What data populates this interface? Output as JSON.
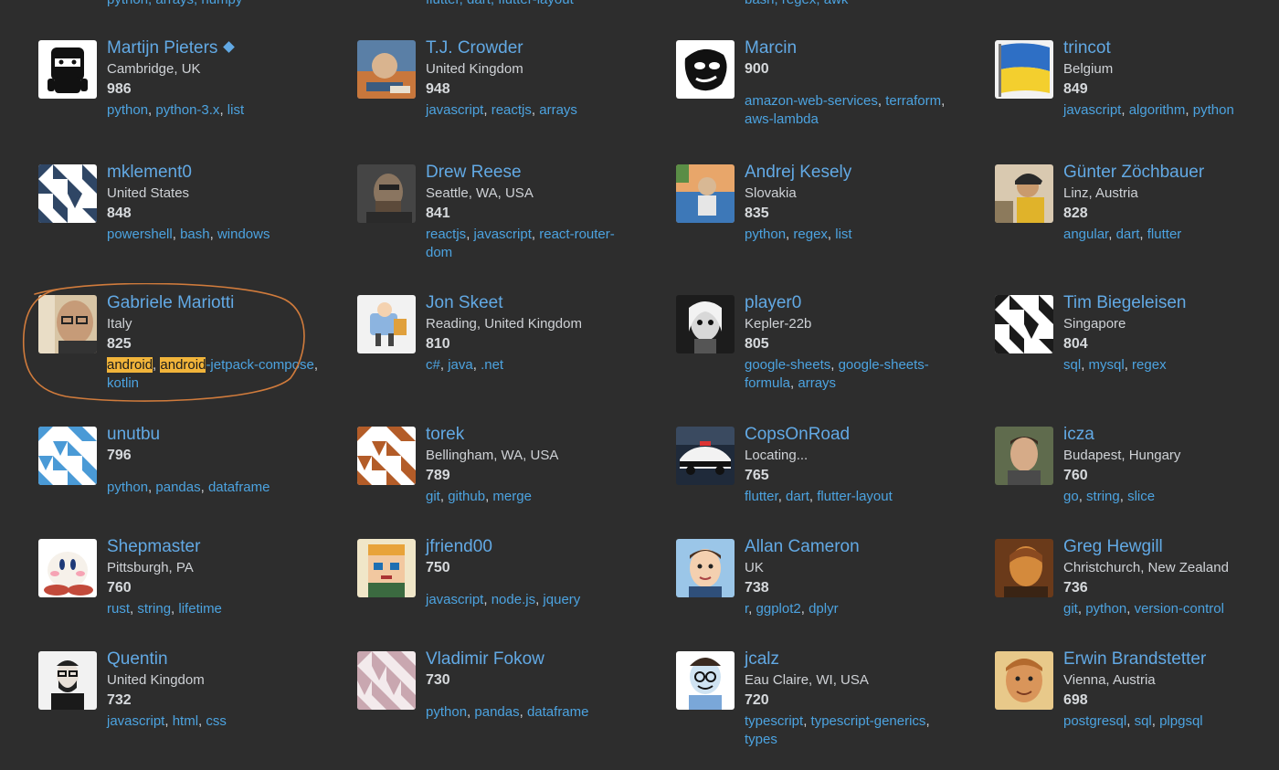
{
  "top_strip": [
    "python, arrays, numpy",
    "flutter, dart, flutter-layout",
    "bash, regex, awk"
  ],
  "users": [
    {
      "name": "Martijn Pieters",
      "moderator": true,
      "location": "Cambridge, UK",
      "score": "986",
      "tags": [
        "python",
        "python-3.x",
        "list"
      ],
      "avatar": "ninja"
    },
    {
      "name": "T.J. Crowder",
      "location": "United Kingdom",
      "score": "948",
      "tags": [
        "javascript",
        "reactjs",
        "arrays"
      ],
      "avatar": "photo-blue"
    },
    {
      "name": "Marcin",
      "location": "",
      "score": "900",
      "tags": [
        "amazon-web-services",
        "terraform",
        "aws-lambda"
      ],
      "avatar": "sketch"
    },
    {
      "name": "trincot",
      "location": "Belgium",
      "score": "849",
      "tags": [
        "javascript",
        "algorithm",
        "python"
      ],
      "avatar": "ukraine-flag"
    },
    {
      "name": "mklement0",
      "location": "United States",
      "score": "848",
      "tags": [
        "powershell",
        "bash",
        "windows"
      ],
      "avatar": "identicon-navy"
    },
    {
      "name": "Drew Reese",
      "location": "Seattle, WA, USA",
      "score": "841",
      "tags": [
        "reactjs",
        "javascript",
        "react-router-dom"
      ],
      "avatar": "photo-dark"
    },
    {
      "name": "Andrej Kesely",
      "location": "Slovakia",
      "score": "835",
      "tags": [
        "python",
        "regex",
        "list"
      ],
      "avatar": "photo-outdoor"
    },
    {
      "name": "Günter Zöchbauer",
      "location": "Linz, Austria",
      "score": "828",
      "tags": [
        "angular",
        "dart",
        "flutter"
      ],
      "avatar": "photo-bike"
    },
    {
      "name": "Gabriele Mariotti",
      "location": "Italy",
      "score": "825",
      "tags": [
        "android",
        "android-jetpack-compose",
        "kotlin"
      ],
      "highlight": "android",
      "avatar": "photo-glasses"
    },
    {
      "name": "Jon Skeet",
      "location": "Reading, United Kingdom",
      "score": "810",
      "tags": [
        "c#",
        "java",
        ".net"
      ],
      "avatar": "cartoon"
    },
    {
      "name": "player0",
      "location": "Kepler-22b",
      "score": "805",
      "tags": [
        "google-sheets",
        "google-sheets-formula",
        "arrays"
      ],
      "avatar": "bw-face"
    },
    {
      "name": "Tim Biegeleisen",
      "location": "Singapore",
      "score": "804",
      "tags": [
        "sql",
        "mysql",
        "regex"
      ],
      "avatar": "identicon-bw"
    },
    {
      "name": "unutbu",
      "location": "",
      "score": "796",
      "tags": [
        "python",
        "pandas",
        "dataframe"
      ],
      "avatar": "identicon-blue"
    },
    {
      "name": "torek",
      "location": "Bellingham, WA, USA",
      "score": "789",
      "tags": [
        "git",
        "github",
        "merge"
      ],
      "avatar": "identicon-brown"
    },
    {
      "name": "CopsOnRoad",
      "location": "Locating...",
      "score": "765",
      "tags": [
        "flutter",
        "dart",
        "flutter-layout"
      ],
      "avatar": "police-car"
    },
    {
      "name": "icza",
      "location": "Budapest, Hungary",
      "score": "760",
      "tags": [
        "go",
        "string",
        "slice"
      ],
      "avatar": "photo-face"
    },
    {
      "name": "Shepmaster",
      "location": "Pittsburgh, PA",
      "score": "760",
      "tags": [
        "rust",
        "string",
        "lifetime"
      ],
      "avatar": "kirby"
    },
    {
      "name": "jfriend00",
      "location": "",
      "score": "750",
      "tags": [
        "javascript",
        "node.js",
        "jquery"
      ],
      "avatar": "pixel-face"
    },
    {
      "name": "Allan Cameron",
      "location": "UK",
      "score": "738",
      "tags": [
        "r",
        "ggplot2",
        "dplyr"
      ],
      "avatar": "cartoon-man"
    },
    {
      "name": "Greg Hewgill",
      "location": "Christchurch, New Zealand",
      "score": "736",
      "tags": [
        "git",
        "python",
        "version-control"
      ],
      "avatar": "photo-orange"
    },
    {
      "name": "Quentin",
      "location": "United Kingdom",
      "score": "732",
      "tags": [
        "javascript",
        "html",
        "css"
      ],
      "avatar": "sketch-beard"
    },
    {
      "name": "Vladimir Fokow",
      "location": "",
      "score": "730",
      "tags": [
        "python",
        "pandas",
        "dataframe"
      ],
      "avatar": "identicon-pink"
    },
    {
      "name": "jcalz",
      "location": "Eau Claire, WI, USA",
      "score": "720",
      "tags": [
        "typescript",
        "typescript-generics",
        "types"
      ],
      "avatar": "cartoon-jcalz"
    },
    {
      "name": "Erwin Brandstetter",
      "location": "Vienna, Austria",
      "score": "698",
      "tags": [
        "postgresql",
        "sql",
        "plpgsql"
      ],
      "avatar": "photo-warm"
    }
  ],
  "colors": {
    "background": "#2d2d2d",
    "link": "#62a9e4",
    "tag": "#4ca3e0",
    "highlight": "#f1b43a",
    "annotation": "#d07b3c"
  }
}
